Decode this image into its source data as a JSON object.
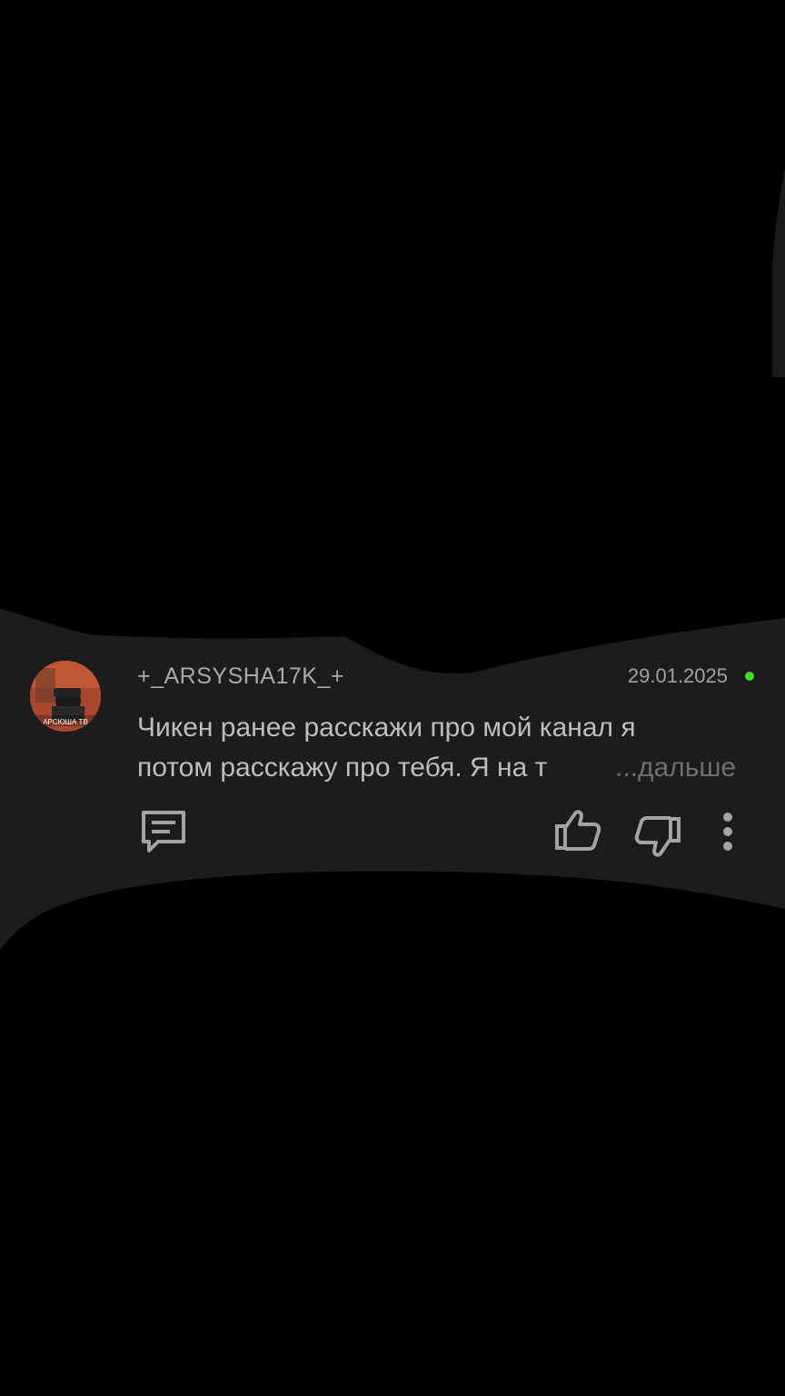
{
  "comment": {
    "author": "+_ARSYSHA17K_+",
    "date": "29.01.2025",
    "text_line1": "Чикен ранее расскажи про мой канал я",
    "text_line2": "потом расскажу про тебя. Я на т",
    "more_label": "...дальше",
    "avatar_caption": "АРСЮША ТВ"
  },
  "actions": {
    "reply_icon": "comment-bubble-icon",
    "like_icon": "thumb-up-icon",
    "dislike_icon": "thumb-down-icon",
    "more_icon": "vertical-ellipsis-icon"
  },
  "colors": {
    "background": "#000000",
    "card": "#1c1c1e",
    "text": "#bdbdbd",
    "muted": "#6f6f6f",
    "online": "#3ee01b"
  }
}
